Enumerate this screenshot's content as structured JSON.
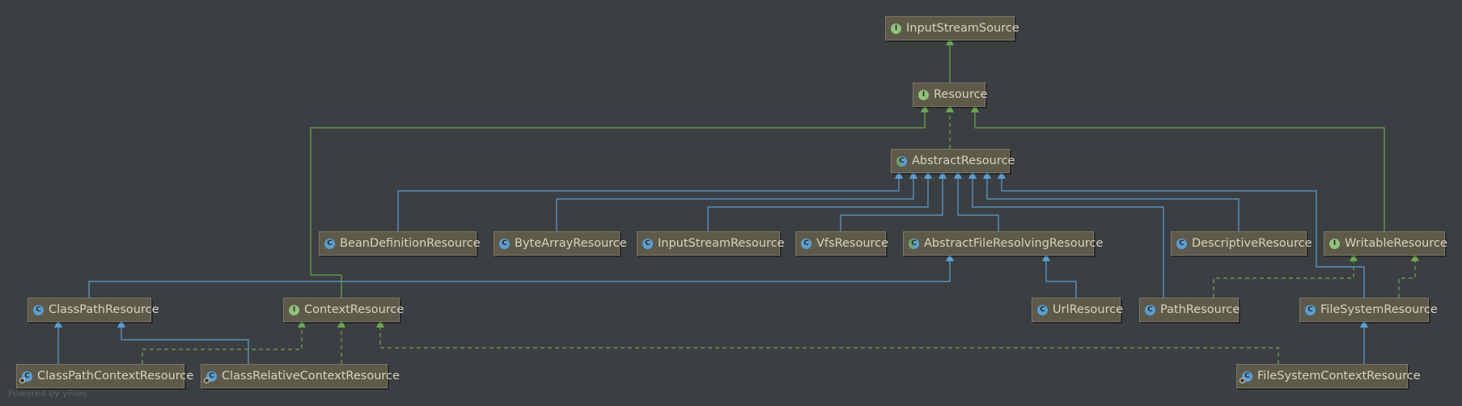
{
  "colors": {
    "background": "#3c3f41",
    "implements": "#6aa84f",
    "extends": "#5a9fd4",
    "node_fill": "#5d5a4a",
    "node_text": "#d7d2c2"
  },
  "nodes": {
    "InputStreamSource": {
      "label": "InputStreamSource",
      "kind": "interface",
      "badge": "I"
    },
    "Resource": {
      "label": "Resource",
      "kind": "interface",
      "badge": "I"
    },
    "AbstractResource": {
      "label": "AbstractResource",
      "kind": "abstract-class",
      "badge": "C"
    },
    "BeanDefinitionResource": {
      "label": "BeanDefinitionResource",
      "kind": "class",
      "badge": "C"
    },
    "ByteArrayResource": {
      "label": "ByteArrayResource",
      "kind": "class",
      "badge": "C"
    },
    "InputStreamResource": {
      "label": "InputStreamResource",
      "kind": "class",
      "badge": "C"
    },
    "VfsResource": {
      "label": "VfsResource",
      "kind": "class",
      "badge": "C"
    },
    "AbstractFileResolvingResource": {
      "label": "AbstractFileResolvingResource",
      "kind": "abstract-class",
      "badge": "C"
    },
    "DescriptiveResource": {
      "label": "DescriptiveResource",
      "kind": "class",
      "badge": "C"
    },
    "WritableResource": {
      "label": "WritableResource",
      "kind": "interface",
      "badge": "I"
    },
    "ClassPathResource": {
      "label": "ClassPathResource",
      "kind": "class",
      "badge": "C"
    },
    "ContextResource": {
      "label": "ContextResource",
      "kind": "interface",
      "badge": "I"
    },
    "UrlResource": {
      "label": "UrlResource",
      "kind": "class",
      "badge": "C"
    },
    "PathResource": {
      "label": "PathResource",
      "kind": "class",
      "badge": "C"
    },
    "FileSystemResource": {
      "label": "FileSystemResource",
      "kind": "class",
      "badge": "C"
    },
    "ClassPathContextResource": {
      "label": "ClassPathContextResource",
      "kind": "inner-class",
      "badge": "C"
    },
    "ClassRelativeContextResource": {
      "label": "ClassRelativeContextResource",
      "kind": "inner-class",
      "badge": "C"
    },
    "FileSystemContextResource": {
      "label": "FileSystemContextResource",
      "kind": "inner-class",
      "badge": "C"
    }
  },
  "edges": [
    {
      "from": "Resource",
      "to": "InputStreamSource",
      "type": "interface-extends"
    },
    {
      "from": "AbstractResource",
      "to": "Resource",
      "type": "implements"
    },
    {
      "from": "ContextResource",
      "to": "Resource",
      "type": "interface-extends"
    },
    {
      "from": "WritableResource",
      "to": "Resource",
      "type": "interface-extends"
    },
    {
      "from": "BeanDefinitionResource",
      "to": "AbstractResource",
      "type": "extends"
    },
    {
      "from": "ByteArrayResource",
      "to": "AbstractResource",
      "type": "extends"
    },
    {
      "from": "InputStreamResource",
      "to": "AbstractResource",
      "type": "extends"
    },
    {
      "from": "VfsResource",
      "to": "AbstractResource",
      "type": "extends"
    },
    {
      "from": "AbstractFileResolvingResource",
      "to": "AbstractResource",
      "type": "extends"
    },
    {
      "from": "PathResource",
      "to": "AbstractResource",
      "type": "extends"
    },
    {
      "from": "DescriptiveResource",
      "to": "AbstractResource",
      "type": "extends"
    },
    {
      "from": "FileSystemResource",
      "to": "AbstractResource",
      "type": "extends"
    },
    {
      "from": "ClassPathResource",
      "to": "AbstractFileResolvingResource",
      "type": "extends"
    },
    {
      "from": "UrlResource",
      "to": "AbstractFileResolvingResource",
      "type": "extends"
    },
    {
      "from": "PathResource",
      "to": "WritableResource",
      "type": "implements"
    },
    {
      "from": "FileSystemResource",
      "to": "WritableResource",
      "type": "implements"
    },
    {
      "from": "ClassPathContextResource",
      "to": "ClassPathResource",
      "type": "extends"
    },
    {
      "from": "ClassRelativeContextResource",
      "to": "ClassPathResource",
      "type": "extends"
    },
    {
      "from": "ClassPathContextResource",
      "to": "ContextResource",
      "type": "implements"
    },
    {
      "from": "ClassRelativeContextResource",
      "to": "ContextResource",
      "type": "implements"
    },
    {
      "from": "FileSystemContextResource",
      "to": "ContextResource",
      "type": "implements"
    },
    {
      "from": "FileSystemContextResource",
      "to": "FileSystemResource",
      "type": "extends"
    }
  ],
  "watermark": "Powered by yFiles"
}
